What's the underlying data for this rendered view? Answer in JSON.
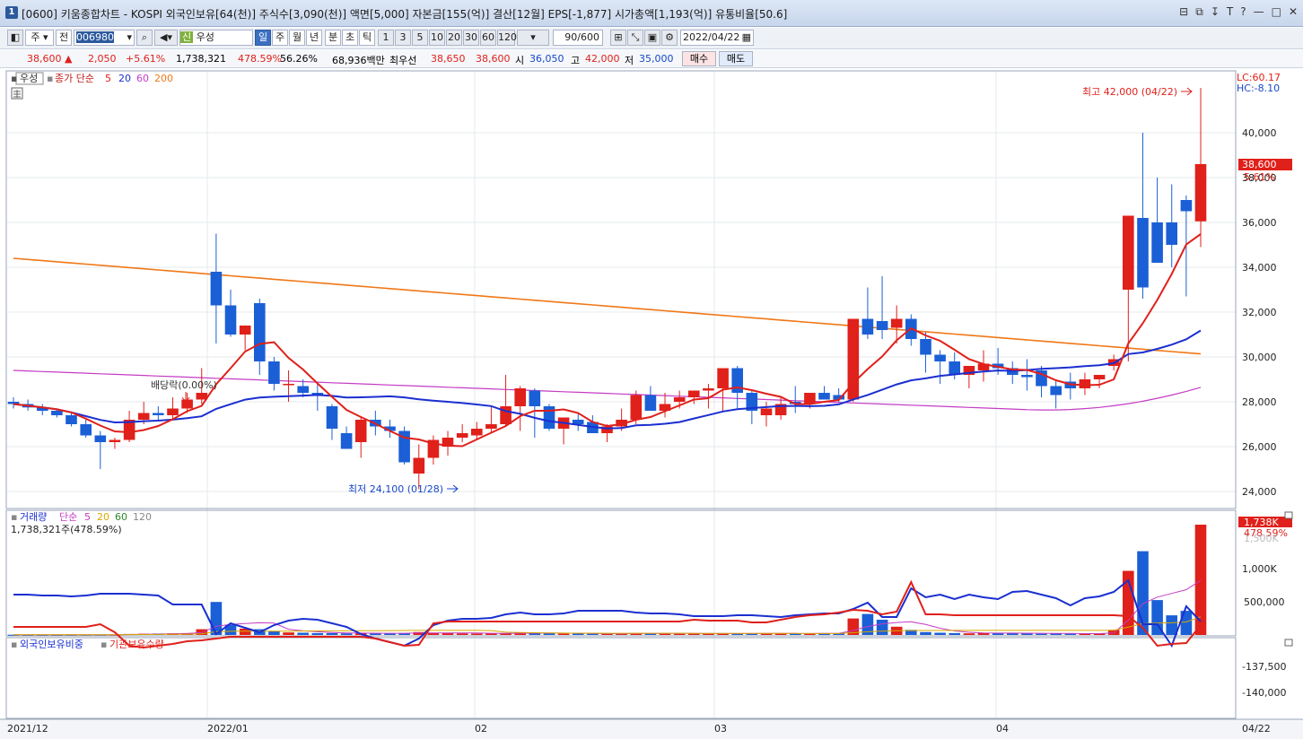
{
  "titlebar": {
    "icon": "1",
    "text": "[0600] 키움종합차트 - KOSPI 외국인보유[64(천)] 주식수[3,090(천)] 액면[5,000] 자본금[155(억)] 결산[12월] EPS[-1,877] 시가총액[1,193(억)] 유통비율[50.6]",
    "controls": [
      "⊟",
      "⧉",
      "↧",
      "T",
      "?",
      "—",
      "□",
      "✕"
    ]
  },
  "toolbar": {
    "period_label": "주",
    "all_label": "전",
    "code_value": "006980",
    "sin_badge": "신",
    "stock_name": "우성",
    "timeframes": [
      "일",
      "주",
      "월",
      "년",
      "분",
      "초",
      "틱"
    ],
    "selected_timeframe": "일",
    "minute_options": [
      "1",
      "3",
      "5",
      "10",
      "20",
      "30",
      "60",
      "120"
    ],
    "count_value": "90/600",
    "date_value": "2022/04/22"
  },
  "quote": {
    "price": "38,600",
    "arrow": "▲",
    "change": "2,050",
    "change_pct": "+5.61%",
    "volume": "1,738,321",
    "vol_ratio": "478.59%",
    "turnover": "56.26%",
    "amount": "68,936백만",
    "pref_label": "최우선",
    "ask": "38,650",
    "bid": "38,600",
    "open_label": "시",
    "open": "36,050",
    "high_label": "고",
    "high": "42,000",
    "low_label": "저",
    "low": "35,000",
    "buy_label": "매수",
    "sell_label": "매도"
  },
  "price_panel": {
    "name_tag": "우성",
    "ma_title": "종가 단순",
    "ma_periods": [
      "5",
      "20",
      "60",
      "200"
    ],
    "ma_colors": [
      "#e0201a",
      "#1a2fd0",
      "#c43cc4",
      "#f07818"
    ],
    "lc_label": "LC:60.17",
    "hc_label": "HC:-8.10",
    "high_annot": "최고 42,000 (04/22)",
    "low_annot": "최저 24,100 (01/28)",
    "div_annot": "배당락(0.00%)",
    "y_ticks": [
      "40,000",
      "38,000",
      "36,000",
      "34,000",
      "32,000",
      "30,000",
      "28,000",
      "26,000",
      "24,000"
    ],
    "cur_price_tag": "38,600",
    "cur_pct_tag": "5.61%"
  },
  "volume_panel": {
    "title": "거래량",
    "ma_title": "단순",
    "ma_periods": [
      "5",
      "20",
      "60",
      "120"
    ],
    "ma_colors": [
      "#c43cc4",
      "#d8a800",
      "#2a8a2a",
      "#888888"
    ],
    "value_text": "1,738,321주(478.59%)",
    "y_ticks": [
      "1,000K",
      "500,000"
    ],
    "cur_tag": "1,738K",
    "cur_pct": "478.59%",
    "hidden_tick": "1,500K"
  },
  "holding_panel": {
    "title1": "외국인보유비중",
    "title2": "기관보유수량",
    "y_ticks": [
      "-137,500",
      "-140,000"
    ]
  },
  "x_axis": {
    "labels": [
      "2021/12",
      "2022/01",
      "02",
      "03",
      "04",
      "04/22"
    ]
  },
  "chart_data": {
    "type": "candlestick",
    "x": [
      "12-21",
      "12-22",
      "12-23",
      "12-24",
      "12-27",
      "12-28",
      "12-29",
      "12-30",
      "01-03",
      "01-04",
      "01-05",
      "01-06",
      "01-07",
      "01-10",
      "01-11",
      "01-12",
      "01-13",
      "01-14",
      "01-17",
      "01-18",
      "01-19",
      "01-20",
      "01-21",
      "01-24",
      "01-25",
      "01-26",
      "01-27",
      "01-28",
      "02-03",
      "02-04",
      "02-07",
      "02-08",
      "02-09",
      "02-10",
      "02-11",
      "02-14",
      "02-15",
      "02-16",
      "02-17",
      "02-18",
      "02-21",
      "02-22",
      "02-23",
      "02-24",
      "02-25",
      "02-28",
      "03-02",
      "03-03",
      "03-04",
      "03-07",
      "03-08",
      "03-10",
      "03-11",
      "03-14",
      "03-15",
      "03-16",
      "03-17",
      "03-18",
      "03-21",
      "03-22",
      "03-23",
      "03-24",
      "03-25",
      "03-28",
      "03-29",
      "03-30",
      "03-31",
      "04-01",
      "04-04",
      "04-05",
      "04-06",
      "04-07",
      "04-08",
      "04-11",
      "04-12",
      "04-13",
      "04-14",
      "04-15",
      "04-18",
      "04-19",
      "04-20",
      "04-21",
      "04-22"
    ],
    "open": [
      28000,
      27900,
      27750,
      27600,
      27400,
      27000,
      26500,
      26200,
      26300,
      27200,
      27500,
      27400,
      27700,
      28100,
      33800,
      32300,
      31000,
      32400,
      29800,
      28800,
      28700,
      28400,
      27800,
      26600,
      26200,
      27200,
      26900,
      26700,
      24800,
      25500,
      26000,
      26400,
      26500,
      26800,
      27000,
      27800,
      28500,
      27800,
      26800,
      27200,
      27100,
      26600,
      26900,
      27200,
      28300,
      27600,
      28000,
      28200,
      28500,
      28600,
      29500,
      28400,
      27400,
      27400,
      28000,
      27900,
      28400,
      28300,
      28100,
      31700,
      31600,
      31300,
      31700,
      30800,
      30100,
      29800,
      29200,
      29400,
      29700,
      29500,
      29200,
      29400,
      28700,
      28900,
      28600,
      29000,
      29600,
      33000,
      36200,
      36000,
      36000,
      37000,
      36050
    ],
    "high": [
      28200,
      28100,
      27900,
      27700,
      27500,
      27200,
      26700,
      26400,
      27600,
      28000,
      27800,
      28200,
      28400,
      29500,
      35500,
      33000,
      31400,
      32600,
      30000,
      29400,
      29000,
      28800,
      27900,
      26900,
      27300,
      27600,
      27200,
      26900,
      26100,
      26500,
      26700,
      27000,
      27100,
      27800,
      29200,
      28700,
      28600,
      27900,
      27100,
      27500,
      27400,
      27000,
      27700,
      28500,
      28700,
      28400,
      28500,
      28500,
      28800,
      29500,
      29600,
      28500,
      28000,
      28200,
      28700,
      28400,
      28700,
      28600,
      31200,
      33100,
      33600,
      32300,
      31900,
      31100,
      30300,
      30200,
      29500,
      30300,
      30400,
      29800,
      29900,
      29600,
      29000,
      29300,
      29300,
      29200,
      30100,
      36100,
      40000,
      38000,
      37700,
      37200,
      42000
    ],
    "low": [
      27700,
      27600,
      27400,
      27300,
      26900,
      26400,
      25000,
      25900,
      26200,
      27000,
      27200,
      27200,
      27500,
      27900,
      30600,
      30900,
      30300,
      29200,
      28500,
      28000,
      28200,
      27600,
      26300,
      25900,
      25500,
      26500,
      26400,
      25200,
      24100,
      25200,
      25600,
      26200,
      26300,
      26600,
      26900,
      26700,
      26400,
      26700,
      26100,
      26700,
      26600,
      26200,
      26700,
      27000,
      27600,
      27300,
      27700,
      27900,
      27700,
      27600,
      27700,
      27000,
      26900,
      27200,
      27500,
      27700,
      28100,
      28000,
      28000,
      30800,
      30800,
      30600,
      30500,
      29300,
      28800,
      29000,
      28600,
      28900,
      29200,
      28800,
      28500,
      28200,
      27700,
      28100,
      28300,
      28600,
      29400,
      29800,
      32600,
      34200,
      34000,
      32700,
      34900
    ],
    "close": [
      27900,
      27750,
      27600,
      27400,
      27000,
      26500,
      26200,
      26300,
      27200,
      27500,
      27400,
      27700,
      28100,
      28400,
      32300,
      31000,
      31400,
      29800,
      28800,
      28800,
      28400,
      28300,
      26800,
      25900,
      27200,
      26900,
      26700,
      25300,
      25500,
      26300,
      26400,
      26600,
      26800,
      27000,
      27800,
      28600,
      27800,
      26800,
      27300,
      27000,
      26600,
      26900,
      27200,
      28300,
      27600,
      27900,
      28200,
      28500,
      28600,
      29500,
      28400,
      27600,
      27700,
      27900,
      27900,
      28400,
      28100,
      28100,
      31700,
      31000,
      31200,
      31700,
      30800,
      30100,
      29800,
      29200,
      29600,
      29700,
      29500,
      29200,
      29100,
      28700,
      28300,
      28600,
      29000,
      29200,
      29900,
      36300,
      33100,
      34200,
      35000,
      36500,
      38600
    ],
    "volume": [
      4000,
      3000,
      3500,
      3000,
      4000,
      5000,
      6000,
      5000,
      15000,
      20000,
      22000,
      25000,
      30000,
      90000,
      520000,
      160000,
      100000,
      90000,
      60000,
      40000,
      35000,
      30000,
      30000,
      25000,
      28000,
      25000,
      25000,
      30000,
      45000,
      35000,
      28000,
      25000,
      22000,
      25000,
      30000,
      35000,
      30000,
      25000,
      20000,
      22000,
      20000,
      18000,
      20000,
      30000,
      28000,
      22000,
      20000,
      22000,
      22000,
      25000,
      25000,
      20000,
      25000,
      25000,
      22000,
      24000,
      22000,
      25000,
      260000,
      330000,
      240000,
      130000,
      80000,
      45000,
      35000,
      30000,
      25000,
      28000,
      32000,
      30000,
      25000,
      20000,
      22000,
      20000,
      22000,
      24000,
      80000,
      1010000,
      1320000,
      550000,
      310000,
      380000,
      1738321
    ],
    "ma5_last": 35600,
    "ma20_last": 31100,
    "ma60_last": 28700,
    "ma200_last": 30250,
    "ylim": [
      23600,
      42000
    ],
    "vol_ylim": [
      0,
      1780000
    ]
  }
}
